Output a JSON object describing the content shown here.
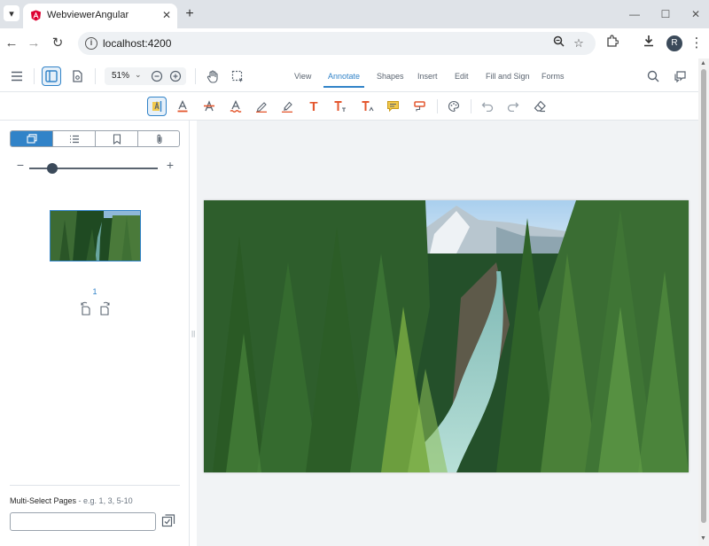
{
  "browser": {
    "tab_title": "WebviewerAngular",
    "url": "localhost:4200",
    "avatar_initial": "R",
    "accent": "#3183c8"
  },
  "header": {
    "zoom_value": "51%",
    "ribbons": [
      "View",
      "Annotate",
      "Shapes",
      "Insert",
      "Edit",
      "Fill and Sign",
      "Forms"
    ],
    "active_ribbon": "Annotate"
  },
  "annotate_tools": [
    "text-highlight",
    "text-underline",
    "text-strikeout",
    "text-squiggly",
    "free-hand",
    "free-hand-highlight",
    "free-text",
    "callout",
    "text-insert",
    "sticky-note",
    "text-replace",
    "style",
    "undo",
    "redo",
    "eraser"
  ],
  "left_panel": {
    "tabs": [
      "thumbnails",
      "outlines",
      "bookmarks",
      "attachments"
    ],
    "thumbnail_zoom_level": 0.18,
    "page_number": "1",
    "multi_select_label": "Multi-Select Pages",
    "multi_select_hint": " - e.g. 1, 3, 5-10",
    "multi_select_value": ""
  },
  "document": {
    "page_count": 1,
    "content": "photo of forest river valley"
  }
}
